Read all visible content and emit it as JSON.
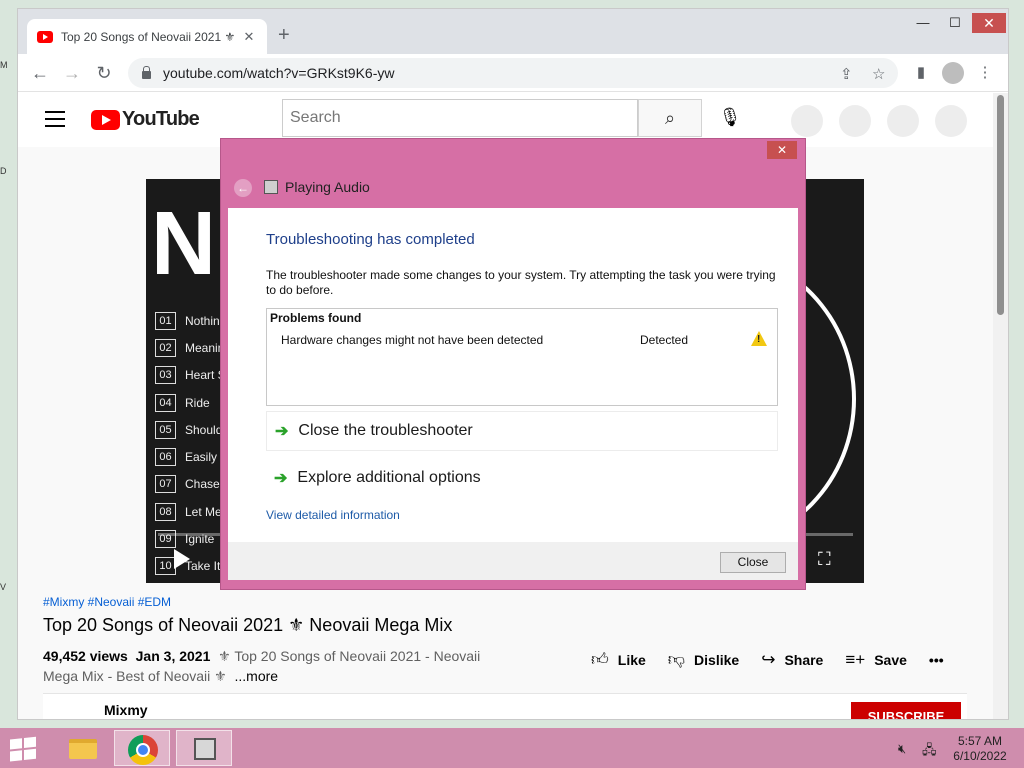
{
  "browser": {
    "tab_title": "Top 20 Songs of Neovaii 2021 ⚜",
    "tab_close": "✕",
    "new_tab": "+",
    "window_controls": {
      "minimize": "—",
      "maximize": "☐",
      "close": "✕"
    },
    "url": "youtube.com/watch?v=GRKst9K6-yw"
  },
  "youtube": {
    "logo_text": "YouTube",
    "search_placeholder": "Search",
    "video": {
      "title_letter": "N",
      "tracks": [
        {
          "num": "01",
          "name": "Nothing"
        },
        {
          "num": "02",
          "name": "Meanin"
        },
        {
          "num": "03",
          "name": "Heart S"
        },
        {
          "num": "04",
          "name": "Ride"
        },
        {
          "num": "05",
          "name": "Should"
        },
        {
          "num": "06",
          "name": "Easily"
        },
        {
          "num": "07",
          "name": "Chase"
        },
        {
          "num": "08",
          "name": "Let Me"
        },
        {
          "num": "09",
          "name": "Ignite"
        },
        {
          "num": "10",
          "name": "Take It"
        }
      ]
    },
    "hashtags": "#Mixmy #Neovaii #EDM",
    "title": "Top 20 Songs of Neovaii 2021 ⚜ Neovaii Mega Mix",
    "views": "49,452 views",
    "date": "Jan 3, 2021",
    "description": "⚜ Top 20 Songs of Neovaii 2021 - Neovaii Mega Mix - Best of Neovaii ⚜",
    "more": "...more",
    "actions": {
      "like": "Like",
      "dislike": "Dislike",
      "share": "Share",
      "save": "Save",
      "more": "•••"
    },
    "channel": "Mixmy",
    "subscribe": "SUBSCRIBE"
  },
  "dialog": {
    "close_x": "✕",
    "title": "Playing Audio",
    "heading": "Troubleshooting has completed",
    "description": "The troubleshooter made some changes to your system. Try attempting the task you were trying to do before.",
    "problems_header": "Problems found",
    "problems": [
      {
        "text": "Hardware changes might not have been detected",
        "status": "Detected"
      }
    ],
    "options": [
      {
        "label": "Close the troubleshooter"
      },
      {
        "label": "Explore additional options"
      }
    ],
    "detail_link": "View detailed information",
    "close_button": "Close"
  },
  "taskbar": {
    "time": "5:57 AM",
    "date": "6/10/2022"
  }
}
